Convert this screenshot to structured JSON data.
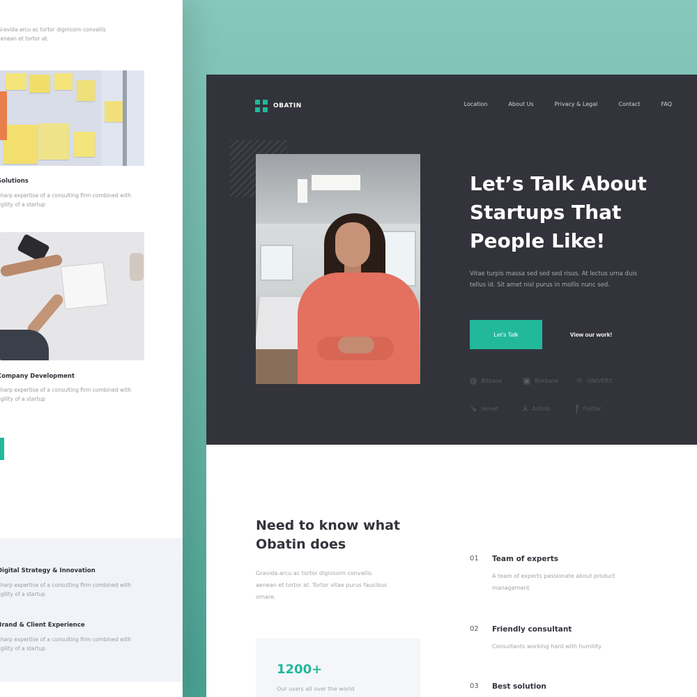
{
  "left_page": {
    "intro_text_1": "Gravida arcu ac tortor dignissim convallis",
    "intro_text_2": "aenean et tortor at.",
    "item1_title": "Solutions",
    "item1_desc_1": "Sharp expertise of a consulting firm combined with",
    "item1_desc_2": "agility of a startup",
    "item2_title": "Company Development",
    "item2_desc_1": "Sharp expertise of a consulting firm combined with",
    "item2_desc_2": "agility of a startup",
    "band_item1_title": "Digital Strategy & Innovation",
    "band_item1_desc_1": "Sharp expertise of a consulting firm combined with",
    "band_item1_desc_2": "agility of a startup",
    "band_item2_title": "Brand & Client Experience",
    "band_item2_desc_1": "Sharp expertise of a consulting firm combined with",
    "band_item2_desc_2": "agility of a startup"
  },
  "brand": {
    "name": "OBATIN",
    "accent_color": "#21b99a",
    "dark_color": "#33333b"
  },
  "nav": {
    "items": [
      "Location",
      "About Us",
      "Privacy & Legal",
      "Contact",
      "FAQ"
    ]
  },
  "hero": {
    "headline_1": "Let’s Talk About",
    "headline_2": "Startups That",
    "headline_3": "People Like!",
    "subtext_1": "Vitae turpis massa sed sed sed risus. At lectus urna duis",
    "subtext_2": "tellus id. Sit amet nisl purus in mollis nunc sed.",
    "primary_button": "Let’s Talk",
    "secondary_button": "View our work!",
    "partners": [
      {
        "name": "Bitbase",
        "icon": "globe-icon"
      },
      {
        "name": "Boxbase",
        "icon": "box-icon"
      },
      {
        "name": "UNIVERS",
        "icon": "sun-icon"
      },
      {
        "name": "Velvet",
        "icon": "leaf-icon"
      },
      {
        "name": "Airbnb",
        "icon": "triangle-icon"
      },
      {
        "name": "Flutter",
        "icon": "feather-icon"
      }
    ]
  },
  "about": {
    "title_1": "Need to know what",
    "title_2": "Obatin does",
    "text_1": "Gravida arcu ac tortor dignissim convallis",
    "text_2": "aenean et tortor at. Tortor vitae purus faucibus",
    "text_3": "ornare.",
    "stat_value": "1200+",
    "stat_label": "Our users all over the world"
  },
  "features": [
    {
      "num": "01",
      "title": "Team of experts",
      "desc_1": "A team of experts passionate about product",
      "desc_2": "management"
    },
    {
      "num": "02",
      "title": "Friendly consultant",
      "desc_1": "Consultants working hard with humility",
      "desc_2": ""
    },
    {
      "num": "03",
      "title": "Best solution",
      "desc_1": "",
      "desc_2": ""
    }
  ]
}
